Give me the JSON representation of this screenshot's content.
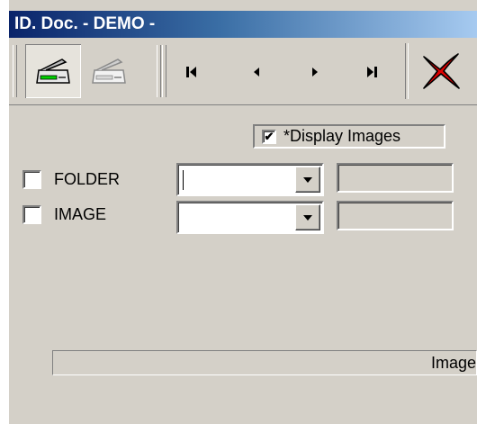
{
  "window": {
    "title": "ID. Doc. - DEMO -"
  },
  "toolbar": {
    "buttons": [
      {
        "name": "scan-active",
        "icon": "scanner-green-icon"
      },
      {
        "name": "scan-inactive",
        "icon": "scanner-gray-icon"
      }
    ],
    "nav": [
      "first-record-icon",
      "previous-record-icon",
      "next-record-icon",
      "last-record-icon"
    ],
    "close_icon": "red-x-icon"
  },
  "display_images": {
    "label": "*Display Images",
    "checked": true
  },
  "rows": [
    {
      "label": "FOLDER",
      "checked": false,
      "combo_value": "",
      "field_value": ""
    },
    {
      "label": "IMAGE",
      "checked": false,
      "combo_value": "",
      "field_value": ""
    }
  ],
  "status": {
    "text": "Image"
  }
}
